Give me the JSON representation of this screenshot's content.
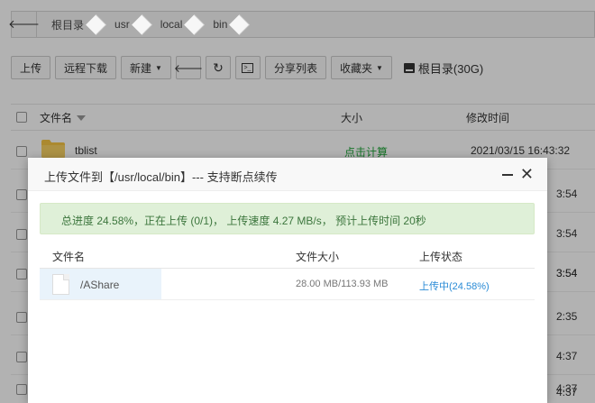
{
  "breadcrumb": [
    "根目录",
    "usr",
    "local",
    "bin"
  ],
  "toolbar": {
    "upload": "上传",
    "remote_download": "远程下载",
    "new": "新建",
    "share_list": "分享列表",
    "favorites": "收藏夹",
    "disk_label": "根目录(30G)"
  },
  "table": {
    "headers": {
      "name": "文件名",
      "size": "大小",
      "modified": "修改时间"
    },
    "rows": [
      {
        "name": "tblist",
        "size": "点击计算",
        "modified": "2021/03/15 16:43:32"
      }
    ],
    "partial_times": [
      "3:54",
      "3:54",
      "3:54",
      "3:54",
      "2:35",
      "4:37",
      "4:37",
      "4:37"
    ]
  },
  "dialog": {
    "title": "上传文件到【/usr/local/bin】--- 支持断点续传",
    "progress_text": "总进度 24.58%，正在上传 (0/1)，   上传速度 4.27 MB/s，   预计上传时间 20秒",
    "headers": {
      "name": "文件名",
      "size": "文件大小",
      "status": "上传状态"
    },
    "file": {
      "name": "/AShare",
      "size": "28.00 MB/113.93 MB",
      "status": "上传中(24.58%)"
    }
  },
  "colors": {
    "accent_green": "#20a53a",
    "progress_bg": "#dff0d8",
    "status_blue": "#2a8bd6"
  }
}
